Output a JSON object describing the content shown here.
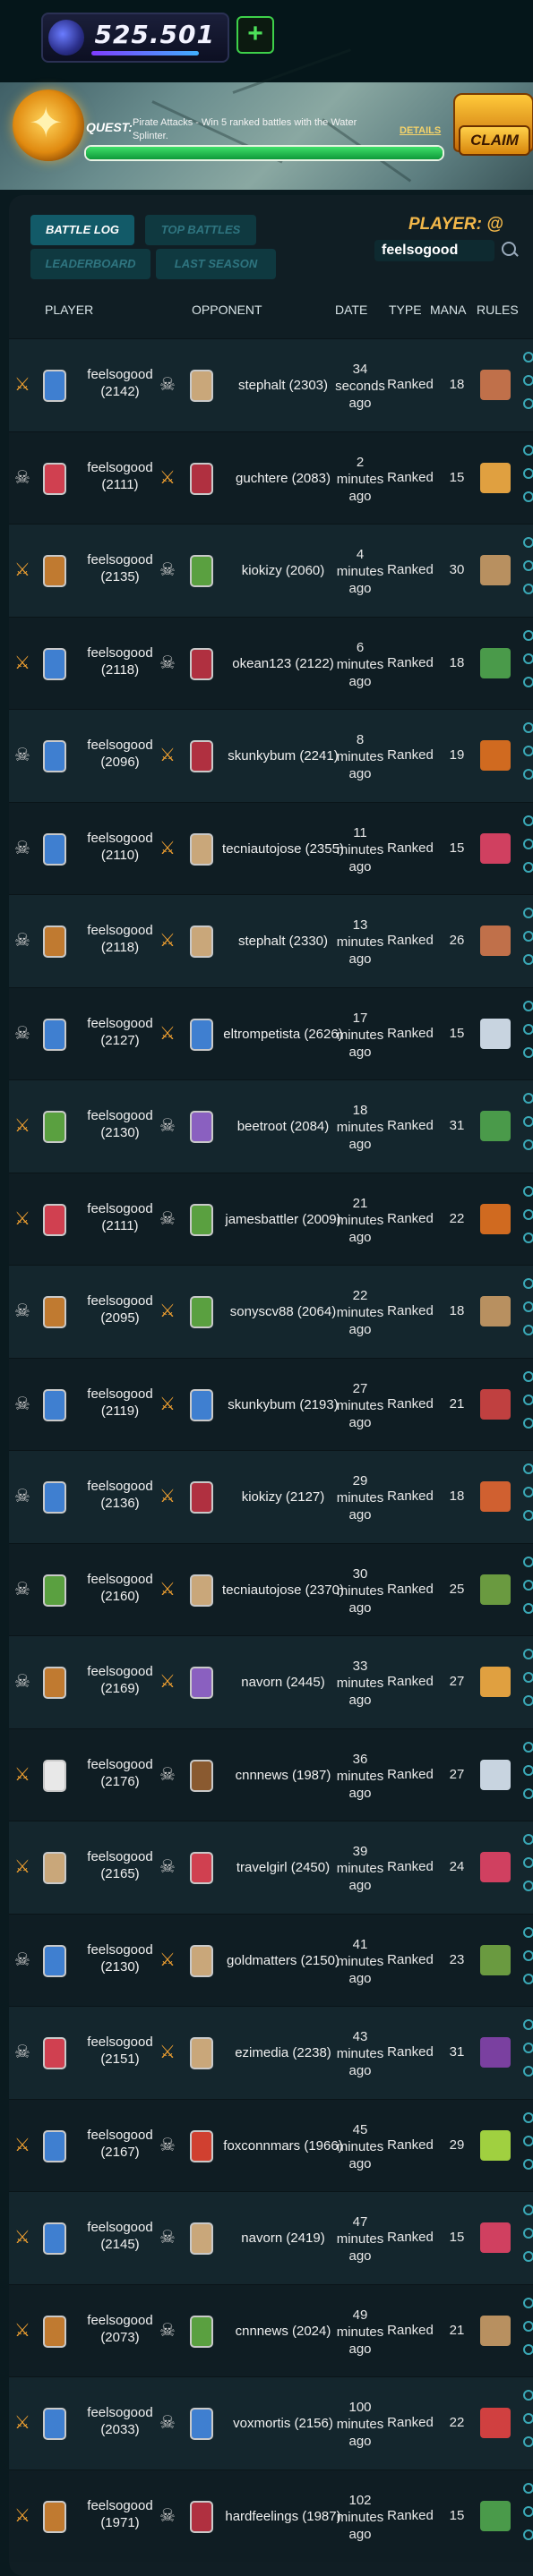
{
  "header": {
    "dec_balance": "525.501",
    "add_label": "+"
  },
  "quest": {
    "label": "QUEST:",
    "text": "Pirate Attacks - Win 5 ranked battles with the Water Splinter.",
    "details_label": "DETAILS",
    "progress": 1.0,
    "claim_label": "CLAIM"
  },
  "tabs": {
    "battle_log": "BATTLE LOG",
    "top_battles": "TOP BATTLES",
    "leaderboard": "LEADERBOARD",
    "last_season": "LAST SEASON"
  },
  "search": {
    "label": "PLAYER: @",
    "value": "feelsogood"
  },
  "table": {
    "headers": {
      "player": "PLAYER",
      "opponent": "OPPONENT",
      "date": "DATE",
      "type": "TYPE",
      "mana": "MANA",
      "rules": "RULES"
    },
    "rows": [
      {
        "player_won": true,
        "player_name": "feelsogood",
        "player_rating": "(2142)",
        "player_color": "#3f7fd0",
        "opp_color": "#c9a77a",
        "opponent": "stephalt (2303)",
        "date": "34 seconds ago",
        "type": "Ranked",
        "mana": "18",
        "rule_icon": "broken-arrow-icon",
        "rule_color": "#c0704a"
      },
      {
        "player_won": false,
        "player_name": "feelsogood",
        "player_rating": "(2111)",
        "player_color": "#d04050",
        "opp_color": "#b03040",
        "opponent": "guchtere (2083)",
        "date": "2 minutes ago",
        "type": "Ranked",
        "mana": "15",
        "rule_icon": "monk-icon",
        "rule_color": "#e0a040"
      },
      {
        "player_won": true,
        "player_name": "feelsogood",
        "player_rating": "(2135)",
        "player_color": "#c07a30",
        "opp_color": "#5aa040",
        "opponent": "kiokizy (2060)",
        "date": "4 minutes ago",
        "type": "Ranked",
        "mana": "30",
        "rule_icon": "hammer-icon",
        "rule_color": "#b89060"
      },
      {
        "player_won": true,
        "player_name": "feelsogood",
        "player_rating": "(2118)",
        "player_color": "#3f7fd0",
        "opp_color": "#b03040",
        "opponent": "okean123 (2122)",
        "date": "6 minutes ago",
        "type": "Ranked",
        "mana": "18",
        "rule_icon": "flag-icon",
        "rule_color": "#4a9a4a"
      },
      {
        "player_won": false,
        "player_name": "feelsogood",
        "player_rating": "(2096)",
        "player_color": "#3f7fd0",
        "opp_color": "#b03040",
        "opponent": "skunkybum (2241)",
        "date": "8 minutes ago",
        "type": "Ranked",
        "mana": "19",
        "rule_icon": "torch-icon",
        "rule_color": "#d06a20"
      },
      {
        "player_won": false,
        "player_name": "feelsogood",
        "player_rating": "(2110)",
        "player_color": "#3f7fd0",
        "opp_color": "#c9a77a",
        "opponent": "tecniautojose (2355)",
        "date": "11 minutes ago",
        "type": "Ranked",
        "mana": "15",
        "rule_icon": "color-wheel-icon",
        "rule_color": "#d04060"
      },
      {
        "player_won": false,
        "player_name": "feelsogood",
        "player_rating": "(2118)",
        "player_color": "#c07a30",
        "opp_color": "#c9a77a",
        "opponent": "stephalt (2330)",
        "date": "13 minutes ago",
        "type": "Ranked",
        "mana": "26",
        "rule_icon": "broken-arrow-icon",
        "rule_color": "#c0704a"
      },
      {
        "player_won": false,
        "player_name": "feelsogood",
        "player_rating": "(2127)",
        "player_color": "#3f7fd0",
        "opp_color": "#3f7fd0",
        "opponent": "eltrompetista (2626)",
        "date": "17 minutes ago",
        "type": "Ranked",
        "mana": "15",
        "rule_icon": "viking-helmet-icon",
        "rule_color": "#c8d4e0"
      },
      {
        "player_won": true,
        "player_name": "feelsogood",
        "player_rating": "(2130)",
        "player_color": "#5aa040",
        "opp_color": "#8a60c0",
        "opponent": "beetroot (2084)",
        "date": "18 minutes ago",
        "type": "Ranked",
        "mana": "31",
        "rule_icon": "flag-icon",
        "rule_color": "#4a9a4a"
      },
      {
        "player_won": true,
        "player_name": "feelsogood",
        "player_rating": "(2111)",
        "player_color": "#d04050",
        "opp_color": "#5aa040",
        "opponent": "jamesbattler (2009)",
        "date": "21 minutes ago",
        "type": "Ranked",
        "mana": "22",
        "rule_icon": "torch-icon",
        "rule_color": "#d06a20"
      },
      {
        "player_won": false,
        "player_name": "feelsogood",
        "player_rating": "(2095)",
        "player_color": "#c07a30",
        "opp_color": "#5aa040",
        "opponent": "sonyscv88 (2064)",
        "date": "22 minutes ago",
        "type": "Ranked",
        "mana": "18",
        "rule_icon": "hammer-icon",
        "rule_color": "#b89060"
      },
      {
        "player_won": false,
        "player_name": "feelsogood",
        "player_rating": "(2119)",
        "player_color": "#3f7fd0",
        "opp_color": "#3f7fd0",
        "opponent": "skunkybum (2193)",
        "date": "27 minutes ago",
        "type": "Ranked",
        "mana": "21",
        "rule_icon": "snail-icon",
        "rule_color": "#c04040"
      },
      {
        "player_won": false,
        "player_name": "feelsogood",
        "player_rating": "(2136)",
        "player_color": "#3f7fd0",
        "opp_color": "#b03040",
        "opponent": "kiokizy (2127)",
        "date": "29 minutes ago",
        "type": "Ranked",
        "mana": "18",
        "rule_icon": "scarecrow-icon",
        "rule_color": "#d06030"
      },
      {
        "player_won": false,
        "player_name": "feelsogood",
        "player_rating": "(2160)",
        "player_color": "#5aa040",
        "opp_color": "#c9a77a",
        "opponent": "tecniautojose (2370)",
        "date": "30 minutes ago",
        "type": "Ranked",
        "mana": "25",
        "rule_icon": "crown-icon",
        "rule_color": "#6a9a40"
      },
      {
        "player_won": false,
        "player_name": "feelsogood",
        "player_rating": "(2169)",
        "player_color": "#c07a30",
        "opp_color": "#8a60c0",
        "opponent": "navorn (2445)",
        "date": "33 minutes ago",
        "type": "Ranked",
        "mana": "27",
        "rule_icon": "monk-icon",
        "rule_color": "#e0a040"
      },
      {
        "player_won": true,
        "player_name": "feelsogood",
        "player_rating": "(2176)",
        "player_color": "#e8e8e8",
        "opp_color": "#8a5a30",
        "opponent": "cnnnews (1987)",
        "date": "36 minutes ago",
        "type": "Ranked",
        "mana": "27",
        "rule_icon": "viking-helmet-icon",
        "rule_color": "#c8d4e0"
      },
      {
        "player_won": true,
        "player_name": "feelsogood",
        "player_rating": "(2165)",
        "player_color": "#c9a77a",
        "opp_color": "#d04050",
        "opponent": "travelgirl (2450)",
        "date": "39 minutes ago",
        "type": "Ranked",
        "mana": "24",
        "rule_icon": "color-wheel-icon",
        "rule_color": "#d04060"
      },
      {
        "player_won": false,
        "player_name": "feelsogood",
        "player_rating": "(2130)",
        "player_color": "#3f7fd0",
        "opp_color": "#c9a77a",
        "opponent": "goldmatters (2150)",
        "date": "41 minutes ago",
        "type": "Ranked",
        "mana": "23",
        "rule_icon": "tree-icon",
        "rule_color": "#6a9a40"
      },
      {
        "player_won": false,
        "player_name": "feelsogood",
        "player_rating": "(2151)",
        "player_color": "#d04050",
        "opp_color": "#c9a77a",
        "opponent": "ezimedia (2238)",
        "date": "43 minutes ago",
        "type": "Ranked",
        "mana": "31",
        "rule_icon": "hooded-figure-icon",
        "rule_color": "#7a40a0"
      },
      {
        "player_won": true,
        "player_name": "feelsogood",
        "player_rating": "(2167)",
        "player_color": "#3f7fd0",
        "opp_color": "#d04030",
        "opponent": "foxconnmars (1966)",
        "date": "45 minutes ago",
        "type": "Ranked",
        "mana": "29",
        "rule_icon": "ghost-icon",
        "rule_color": "#a0d040"
      },
      {
        "player_won": true,
        "player_name": "feelsogood",
        "player_rating": "(2145)",
        "player_color": "#3f7fd0",
        "opp_color": "#c9a77a",
        "opponent": "navorn (2419)",
        "date": "47 minutes ago",
        "type": "Ranked",
        "mana": "15",
        "rule_icon": "color-wheel-icon",
        "rule_color": "#d04060"
      },
      {
        "player_won": true,
        "player_name": "feelsogood",
        "player_rating": "(2073)",
        "player_color": "#c07a30",
        "opp_color": "#5aa040",
        "opponent": "cnnnews (2024)",
        "date": "49 minutes ago",
        "type": "Ranked",
        "mana": "21",
        "rule_icon": "hammer-icon",
        "rule_color": "#b89060"
      },
      {
        "player_won": true,
        "player_name": "feelsogood",
        "player_rating": "(2033)",
        "player_color": "#3f7fd0",
        "opp_color": "#3f7fd0",
        "opponent": "voxmortis (2156)",
        "date": "100 minutes ago",
        "type": "Ranked",
        "mana": "22",
        "rule_icon": "target-icon",
        "rule_color": "#d04040"
      },
      {
        "player_won": true,
        "player_name": "feelsogood",
        "player_rating": "(1971)",
        "player_color": "#c07a30",
        "opp_color": "#b03040",
        "opponent": "hardfeelings (1987)",
        "date": "102 minutes ago",
        "type": "Ranked",
        "mana": "15",
        "rule_icon": "sword-icon",
        "rule_color": "#4a9a4a"
      }
    ]
  }
}
